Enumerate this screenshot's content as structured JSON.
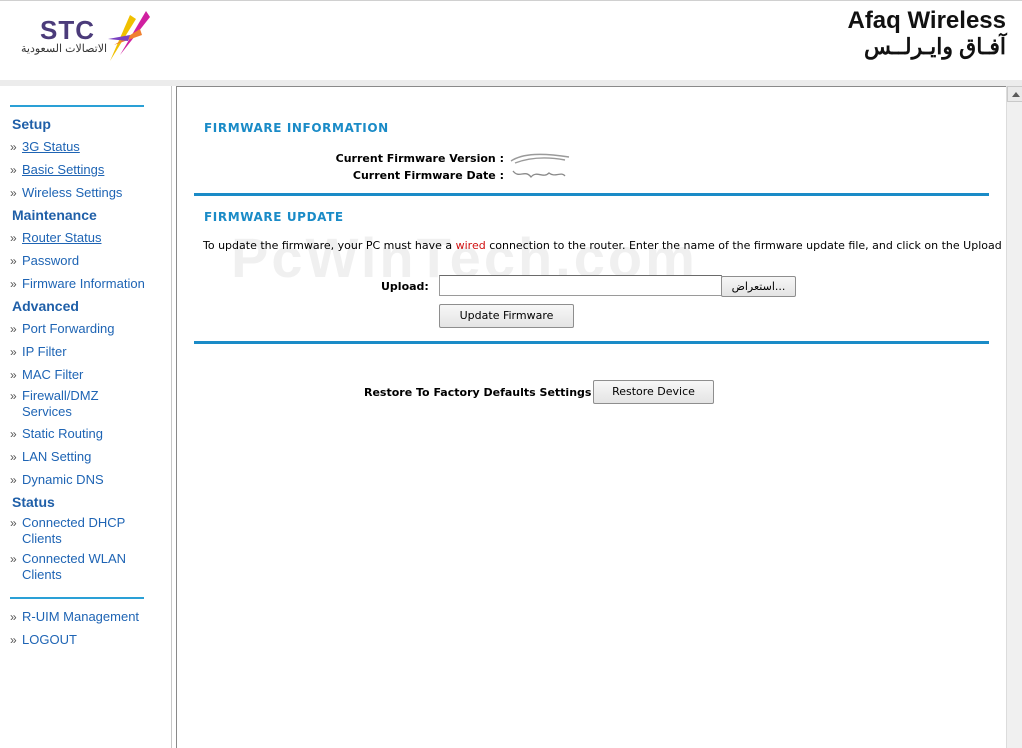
{
  "header": {
    "logo_text": "STC",
    "logo_arabic": "الاتصالات السعودية",
    "brand_en": "Afaq Wireless",
    "brand_ar": "آفـاق وايـرلــس"
  },
  "sidebar": {
    "sections": [
      {
        "title": "Setup",
        "items": [
          "3G Status",
          "Basic Settings",
          "Wireless Settings"
        ]
      },
      {
        "title": "Maintenance",
        "items": [
          "Router Status",
          "Password",
          "Firmware Information"
        ]
      },
      {
        "title": "Advanced",
        "items": [
          "Port Forwarding",
          "IP Filter",
          "MAC Filter",
          "Firewall/DMZ Services",
          "Static Routing",
          "LAN Setting",
          "Dynamic DNS"
        ]
      },
      {
        "title": "Status",
        "items": [
          "Connected DHCP Clients",
          "Connected WLAN Clients"
        ]
      }
    ],
    "extra": [
      "R-UIM Management",
      "LOGOUT"
    ],
    "bullet": "»"
  },
  "main": {
    "firmware_info": {
      "heading": "FIRMWARE INFORMATION",
      "version_label": "Current Firmware Version :",
      "date_label": "Current Firmware Date :"
    },
    "firmware_update": {
      "heading": "FIRMWARE UPDATE",
      "note_before": "To update the firmware, your PC must have a ",
      "note_wired": "wired",
      "note_after": " connection to the router. Enter the name of the firmware update file, and click on the Upload button.",
      "upload_label": "Upload:",
      "browse_label": "استعراض...",
      "update_button": "Update Firmware"
    },
    "restore": {
      "label": "Restore To Factory Defaults Settings :",
      "button": "Restore Device"
    },
    "watermark": "PcWinTech.com"
  },
  "colors": {
    "accent": "#1a8bc7",
    "nav_link": "#1e64b4",
    "section_title": "#1f5fa8",
    "wired_highlight": "#d01010"
  }
}
